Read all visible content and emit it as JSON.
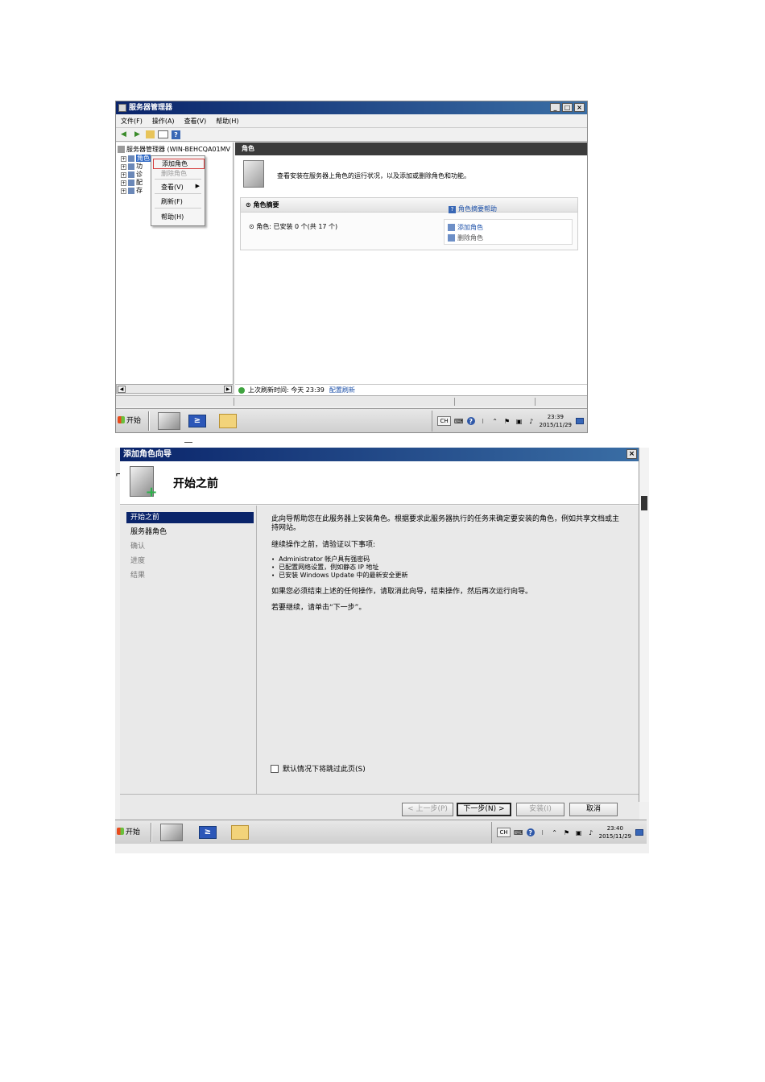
{
  "server_manager": {
    "title": "服务器管理器",
    "window_buttons": [
      "_",
      "□",
      "×"
    ],
    "menu": [
      "文件(F)",
      "操作(A)",
      "查看(V)",
      "帮助(H)"
    ],
    "toolbar_icons": [
      "back-arrow-icon",
      "forward-arrow-icon",
      "up-folder-icon",
      "show-hide-tree-icon",
      "help-icon"
    ],
    "tree": {
      "root": "服务器管理器 (WIN-BEHCQA01MV",
      "nodes": [
        "角色",
        "功",
        "诊",
        "配",
        "存"
      ]
    },
    "context_menu": {
      "items": [
        "添加角色",
        "删除角色",
        "查看(V)",
        "刷新(F)",
        "帮助(H)"
      ]
    },
    "main": {
      "header": "角色",
      "intro": "查看安装在服务器上角色的运行状况，以及添加或删除角色和功能。",
      "summary_title": "角色摘要",
      "summary_help": "角色摘要帮助",
      "roles_status": "角色: 已安装 0 个(共 17 个)",
      "add_role": "添加角色",
      "remove_role": "删除角色"
    },
    "status": {
      "last_refresh": "上次刷新时间: 今天 23:39",
      "configure_refresh": "配置刷新"
    }
  },
  "taskbar1": {
    "start": "开始",
    "lang": "CH",
    "time": "23:39",
    "date": "2015/11/29"
  },
  "wizard": {
    "title": "添加角色向导",
    "heading": "开始之前",
    "steps": [
      "开始之前",
      "服务器角色",
      "确认",
      "进度",
      "结果"
    ],
    "intro": "此向导帮助您在此服务器上安装角色。根据要求此服务器执行的任务来确定要安装的角色，例如共享文档或主持网站。",
    "before_continue": "继续操作之前，请验证以下事项:",
    "bullets": [
      "Administrator 帐户具有强密码",
      "已配置网络设置，例如静态 IP 地址",
      "已安装 Windows Update 中的最新安全更新"
    ],
    "if_must": "如果您必须结束上述的任何操作，请取消此向导，结束操作，然后再次运行向导。",
    "to_continue": "若要继续，请单击“下一步”。",
    "skip_checkbox": "默认情况下将跳过此页(S)",
    "buttons": {
      "back": "< 上一步(P)",
      "next": "下一步(N) >",
      "install": "安装(I)",
      "cancel": "取消"
    }
  },
  "taskbar2": {
    "start": "开始",
    "lang": "CH",
    "time": "23:40",
    "date": "2015/11/29"
  }
}
